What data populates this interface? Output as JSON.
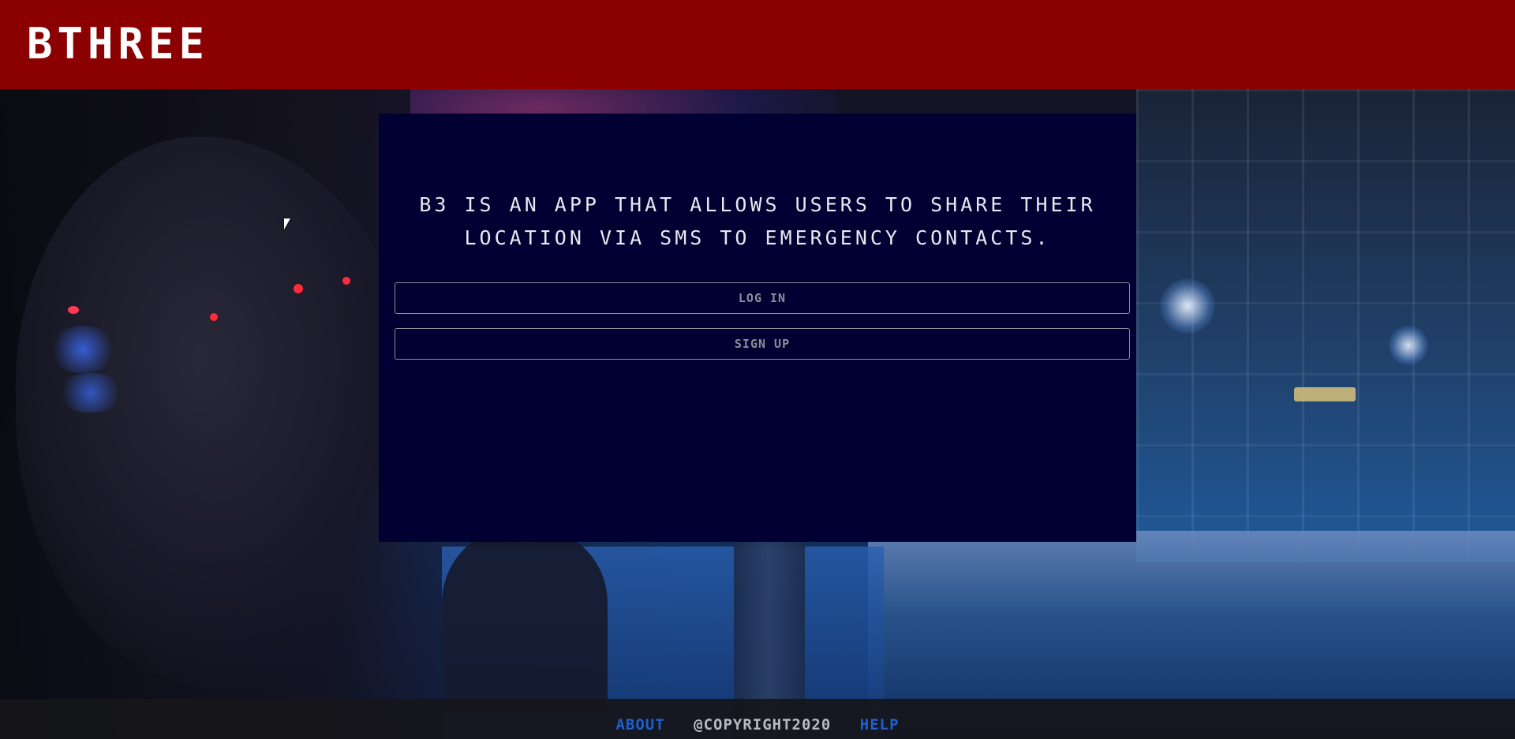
{
  "header": {
    "logo_text": "BTHREE",
    "background_color": "#8b0000"
  },
  "card": {
    "tagline": "B3 IS AN APP THAT ALLOWS USERS TO SHARE THEIR LOCATION VIA SMS TO EMERGENCY CONTACTS.",
    "background_color": "#000033",
    "buttons": {
      "login_label": "LOG IN",
      "signup_label": "SIGN UP"
    }
  },
  "footer": {
    "about_label": "ABOUT",
    "copyright_text": "@COPYRIGHT2020",
    "help_label": "HELP",
    "link_color": "#1f5fcf"
  },
  "background": {
    "icon": "night-city-street-photo"
  }
}
